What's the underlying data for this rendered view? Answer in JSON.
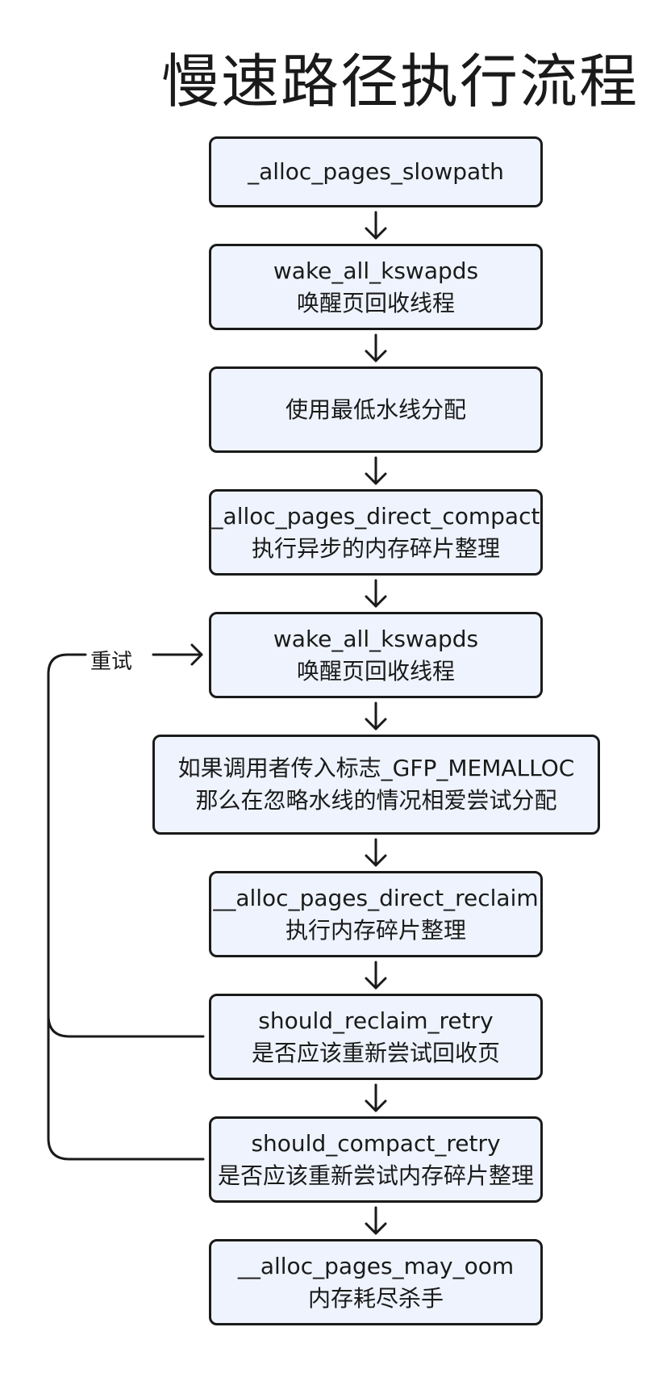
{
  "title": "慢速路径执行流程",
  "retry_label": "重试",
  "nodes": [
    {
      "line1": "_alloc_pages_slowpath",
      "line2": ""
    },
    {
      "line1": "wake_all_kswapds",
      "line2": "唤醒页回收线程"
    },
    {
      "line1": "使用最低水线分配",
      "line2": ""
    },
    {
      "line1": "_alloc_pages_direct_compact",
      "line2": "执行异步的内存碎片整理"
    },
    {
      "line1": "wake_all_kswapds",
      "line2": "唤醒页回收线程"
    },
    {
      "line1": "如果调用者传入标志_GFP_MEMALLOC",
      "line2": "那么在忽略水线的情况相爱尝试分配"
    },
    {
      "line1": "__alloc_pages_direct_reclaim",
      "line2": "执行内存碎片整理"
    },
    {
      "line1": "should_reclaim_retry",
      "line2": "是否应该重新尝试回收页"
    },
    {
      "line1": "should_compact_retry",
      "line2": "是否应该重新尝试内存碎片整理"
    },
    {
      "line1": "__alloc_pages_may_oom",
      "line2": "内存耗尽杀手"
    }
  ],
  "colors": {
    "node_fill": "#eef3fd",
    "node_border": "#1a1a1a",
    "line": "#1a1a1a"
  }
}
